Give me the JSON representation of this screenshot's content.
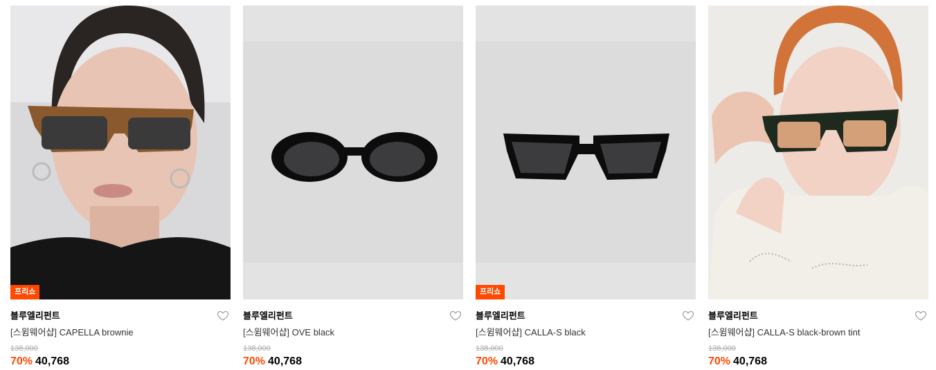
{
  "colors": {
    "accent": "#ff4800",
    "muted": "#aaaaaa"
  },
  "products": [
    {
      "badge": "프리쇼",
      "brand": "블루엘리펀트",
      "name": "[스윔웨어샵] CAPELLA brownie",
      "original_price": "138,000",
      "discount": "70%",
      "price": "40,768",
      "image": "model-wearing-brown-sunglasses"
    },
    {
      "badge": "",
      "brand": "블루엘리펀트",
      "name": "[스윔웨어샵] OVE black",
      "original_price": "138,000",
      "discount": "70%",
      "price": "40,768",
      "image": "black-oval-sunglasses"
    },
    {
      "badge": "프리쇼",
      "brand": "블루엘리펀트",
      "name": "[스윔웨어샵] CALLA-S black",
      "original_price": "138,000",
      "discount": "70%",
      "price": "40,768",
      "image": "black-square-sunglasses"
    },
    {
      "badge": "",
      "brand": "블루엘리펀트",
      "name": "[스윔웨어샵] CALLA-S black-brown tint",
      "original_price": "138,000",
      "discount": "70%",
      "price": "40,768",
      "image": "model-wearing-tinted-sunglasses"
    }
  ]
}
